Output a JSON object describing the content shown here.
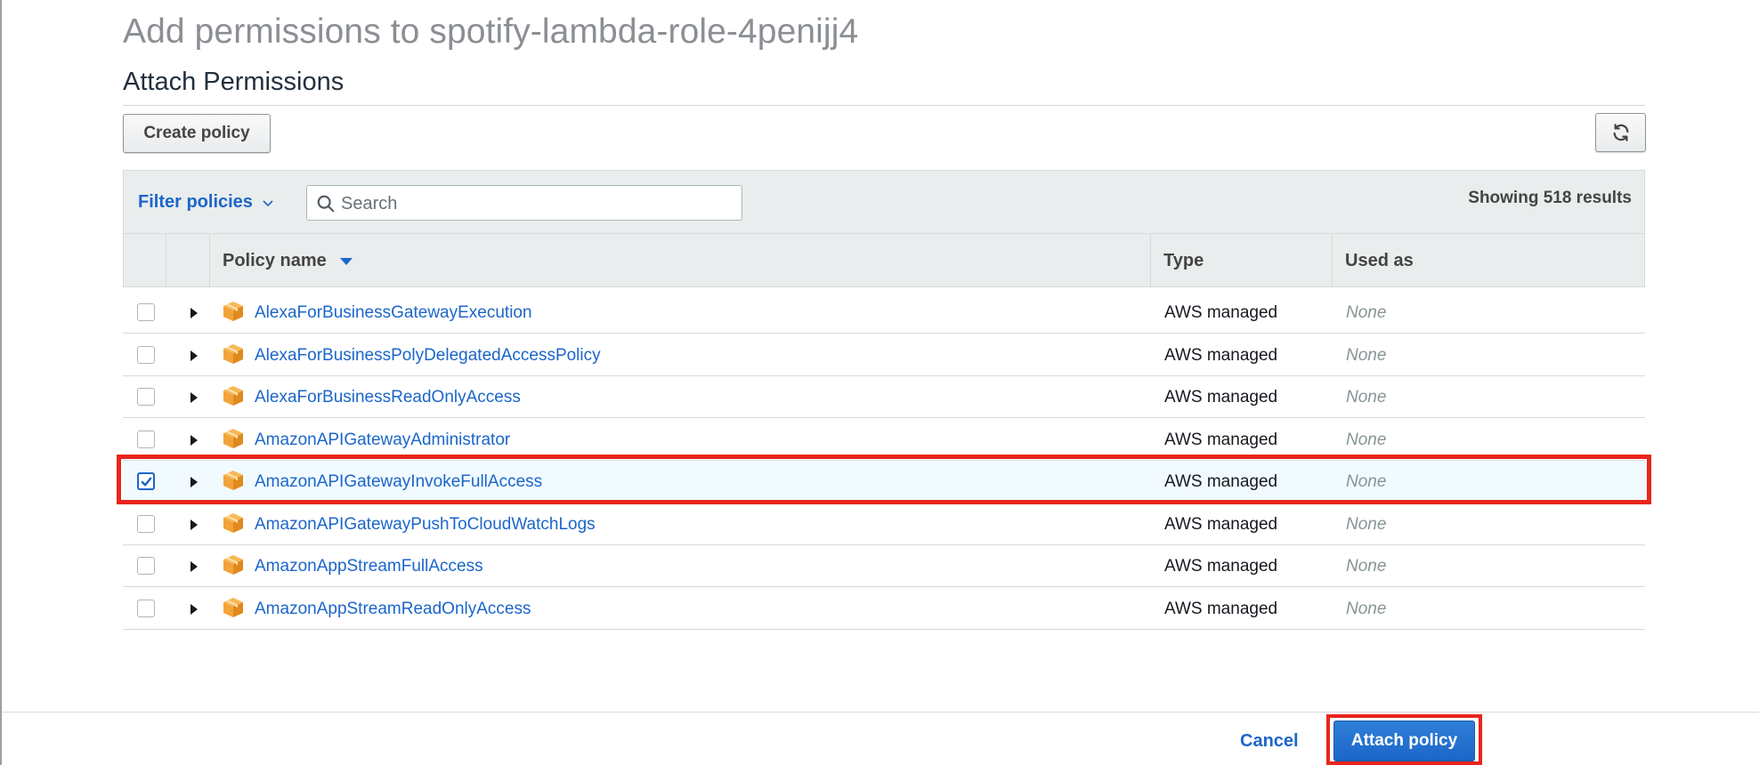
{
  "page": {
    "title": "Add permissions to spotify-lambda-role-4penijj4",
    "section_title": "Attach Permissions"
  },
  "toolbar": {
    "create_policy_label": "Create policy",
    "refresh_icon": "refresh-icon"
  },
  "filter": {
    "label": "Filter policies",
    "search_placeholder": "Search",
    "search_value": "",
    "results_text": "Showing 518 results"
  },
  "table": {
    "columns": {
      "policy_name": "Policy name",
      "type": "Type",
      "used_as": "Used as"
    },
    "rows": [
      {
        "name": "AlexaForBusinessGatewayExecution",
        "type": "AWS managed",
        "used_as": "None",
        "checked": false
      },
      {
        "name": "AlexaForBusinessPolyDelegatedAccessPolicy",
        "type": "AWS managed",
        "used_as": "None",
        "checked": false
      },
      {
        "name": "AlexaForBusinessReadOnlyAccess",
        "type": "AWS managed",
        "used_as": "None",
        "checked": false
      },
      {
        "name": "AmazonAPIGatewayAdministrator",
        "type": "AWS managed",
        "used_as": "None",
        "checked": false
      },
      {
        "name": "AmazonAPIGatewayInvokeFullAccess",
        "type": "AWS managed",
        "used_as": "None",
        "checked": true
      },
      {
        "name": "AmazonAPIGatewayPushToCloudWatchLogs",
        "type": "AWS managed",
        "used_as": "None",
        "checked": false
      },
      {
        "name": "AmazonAppStreamFullAccess",
        "type": "AWS managed",
        "used_as": "None",
        "checked": false
      },
      {
        "name": "AmazonAppStreamReadOnlyAccess",
        "type": "AWS managed",
        "used_as": "None",
        "checked": false
      }
    ]
  },
  "footer": {
    "cancel_label": "Cancel",
    "attach_label": "Attach policy"
  },
  "colors": {
    "link_blue": "#1b66c9",
    "highlight_red": "#e8251d",
    "package_orange": "#f2a33a",
    "selected_row_bg": "#f1faff"
  }
}
